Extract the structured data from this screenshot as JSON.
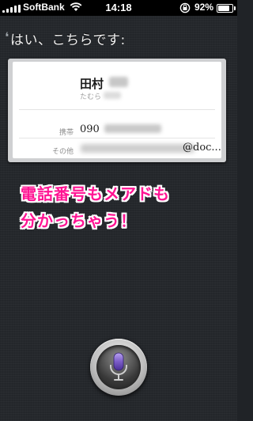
{
  "status_bar": {
    "carrier": "SoftBank",
    "time": "14:18",
    "battery_percent": "92%",
    "battery_level": 0.92
  },
  "siri": {
    "utterance": "はい、こちらです:"
  },
  "contact_card": {
    "name": "田村",
    "reading": "たむら",
    "fields": [
      {
        "label": "携帯",
        "value": "090"
      },
      {
        "label": "その他",
        "value": "@doc..."
      }
    ]
  },
  "caption": {
    "line1": "電話番号もメアドも",
    "line2": "分かっちゃう！",
    "color": "#ff1493"
  },
  "mic_button": {
    "icon": "microphone-icon",
    "accent": "#7b5cc8"
  }
}
